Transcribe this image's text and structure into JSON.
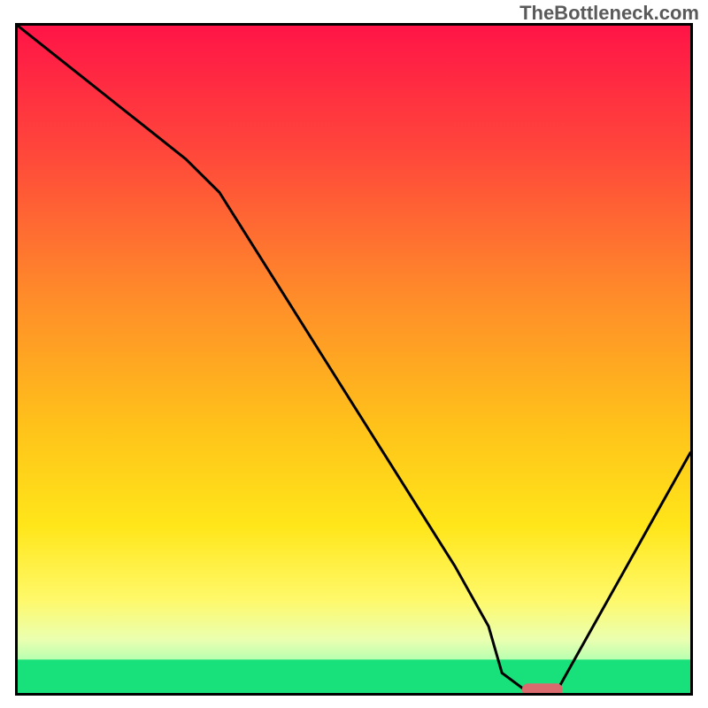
{
  "watermark": "TheBottleneck.com",
  "chart_data": {
    "type": "line",
    "title": "",
    "xlabel": "",
    "ylabel": "",
    "xlim": [
      0,
      100
    ],
    "ylim": [
      0,
      100
    ],
    "x": [
      0,
      5,
      10,
      15,
      20,
      25,
      30,
      35,
      40,
      45,
      50,
      55,
      60,
      65,
      70,
      72,
      76,
      80,
      85,
      90,
      95,
      100
    ],
    "values": [
      100,
      96,
      92,
      88,
      84,
      80,
      75,
      67,
      59,
      51,
      43,
      35,
      27,
      19,
      10,
      3,
      0,
      0,
      9,
      18,
      27,
      36
    ],
    "green_band": {
      "y0": 0,
      "y1": 5
    },
    "marker": {
      "x": 78,
      "y": 0.5,
      "color": "#d96b6e"
    }
  },
  "colors": {
    "gradient_stops": [
      {
        "offset": 0.0,
        "color": "#ff1447"
      },
      {
        "offset": 0.2,
        "color": "#ff4a3a"
      },
      {
        "offset": 0.4,
        "color": "#ff8a2a"
      },
      {
        "offset": 0.6,
        "color": "#ffc21a"
      },
      {
        "offset": 0.75,
        "color": "#ffe61a"
      },
      {
        "offset": 0.86,
        "color": "#fff96a"
      },
      {
        "offset": 0.92,
        "color": "#eaffb0"
      },
      {
        "offset": 0.96,
        "color": "#a8ffb0"
      },
      {
        "offset": 1.0,
        "color": "#18e07a"
      }
    ]
  }
}
